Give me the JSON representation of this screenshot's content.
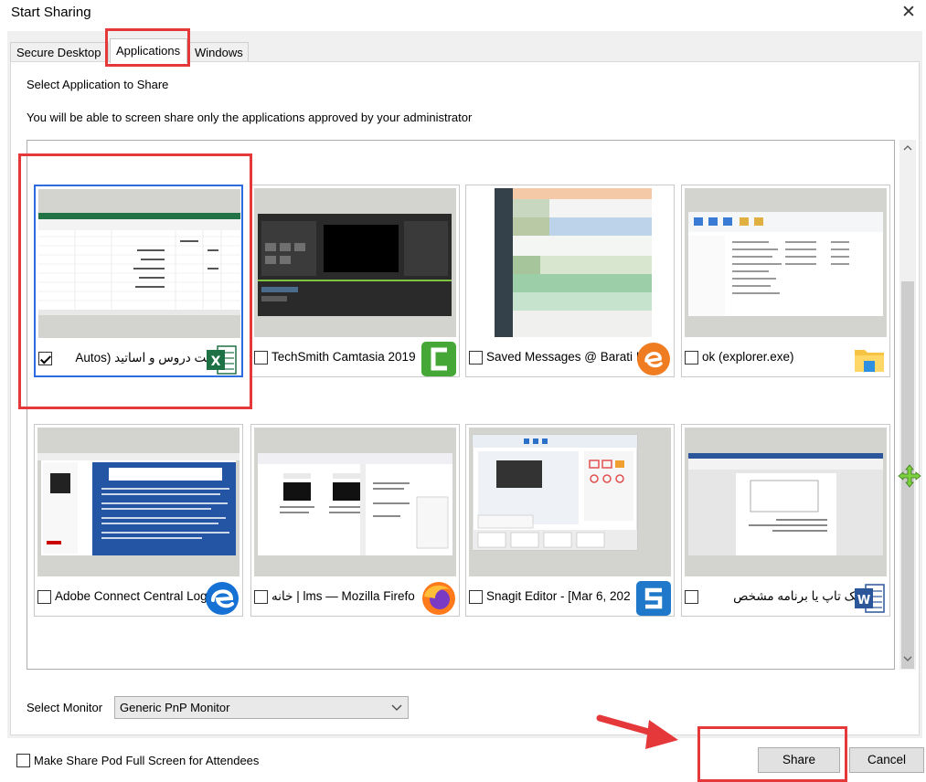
{
  "window": {
    "title": "Start Sharing"
  },
  "tabs": [
    {
      "label": "Secure Desktop"
    },
    {
      "label": "Applications"
    },
    {
      "label": "Windows"
    }
  ],
  "content": {
    "heading": "Select Application to Share",
    "info": "You will be able to screen share only the applications approved by your administrator"
  },
  "apps": [
    {
      "label": "لیست دروس و اساتید (Autos",
      "checked": true,
      "icon": "excel-icon"
    },
    {
      "label": "TechSmith Camtasia 2019",
      "checked": false,
      "icon": "camtasia-icon"
    },
    {
      "label": "Saved Messages @ Barati I",
      "checked": false,
      "icon": "eitaa-icon"
    },
    {
      "label": "ok (explorer.exe)",
      "checked": false,
      "icon": "file-explorer-icon"
    },
    {
      "label": "Adobe Connect Central Log",
      "checked": false,
      "icon": "edge-icon"
    },
    {
      "label": "خانه | lms — Mozilla Firefo",
      "checked": false,
      "icon": "firefox-icon"
    },
    {
      "label": "Snagit Editor - [Mar 6, 202",
      "checked": false,
      "icon": "snagit-icon"
    },
    {
      "label": "دسک تاپ یا برنامه مشخص",
      "checked": false,
      "icon": "word-icon"
    }
  ],
  "monitor": {
    "label": "Select Monitor",
    "selected": "Generic PnP Monitor"
  },
  "footer": {
    "fullscreen_label": "Make Share Pod Full Screen for Attendees",
    "share_label": "Share",
    "cancel_label": "Cancel"
  },
  "colors": {
    "selection": "#2d6be0",
    "annotation": "#e5383b"
  }
}
